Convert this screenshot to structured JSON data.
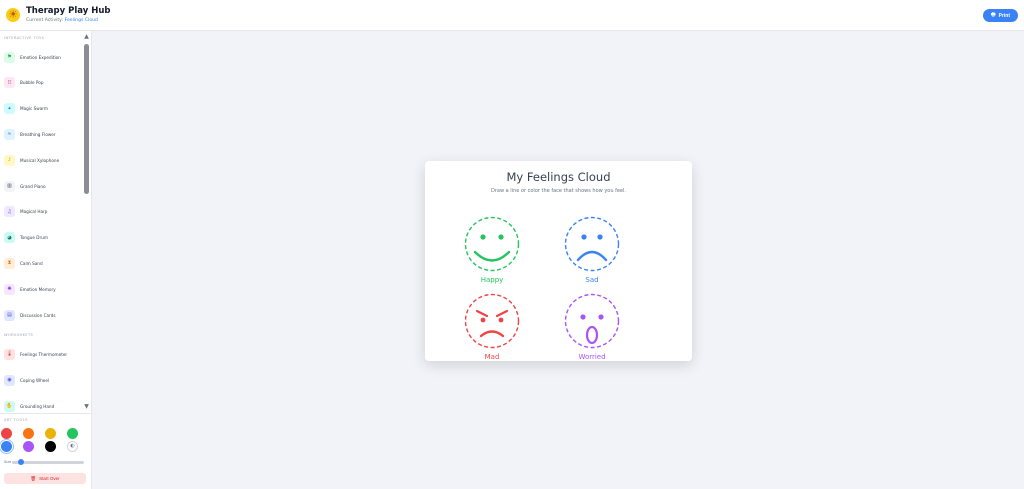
{
  "header": {
    "app_title": "Therapy Play Hub",
    "activity_prefix": "Current Activity:",
    "activity_name": "Feelings Cloud",
    "print_label": "Print"
  },
  "sidebar": {
    "interactive_label": "INTERACTIVE TOYS",
    "interactive": [
      {
        "label": "Emotion Expedition",
        "icon": "flag-icon",
        "bg": "#dcfce7",
        "fg": "#16a34a"
      },
      {
        "label": "Bubble Pop",
        "icon": "bubbles-icon",
        "bg": "#fce7f3",
        "fg": "#db2777"
      },
      {
        "label": "Magic Swarm",
        "icon": "sparkles-icon",
        "bg": "#cffafe",
        "fg": "#0891b2"
      },
      {
        "label": "Breathing Flower",
        "icon": "wind-icon",
        "bg": "#e0f2fe",
        "fg": "#0284c7"
      },
      {
        "label": "Musical Xylophone",
        "icon": "music-note-icon",
        "bg": "#fef9c3",
        "fg": "#ca8a04"
      },
      {
        "label": "Grand Piano",
        "icon": "piano-icon",
        "bg": "#f3f4f6",
        "fg": "#374151"
      },
      {
        "label": "Magical Harp",
        "icon": "harp-icon",
        "bg": "#ede9fe",
        "fg": "#7c3aed"
      },
      {
        "label": "Tongue Drum",
        "icon": "drum-icon",
        "bg": "#ccfbf1",
        "fg": "#0f766e"
      },
      {
        "label": "Calm Sand",
        "icon": "hourglass-icon",
        "bg": "#ffedd5",
        "fg": "#ea580c"
      },
      {
        "label": "Emotion Memory",
        "icon": "brain-icon",
        "bg": "#f3e8ff",
        "fg": "#9333ea"
      },
      {
        "label": "Discussion Cards",
        "icon": "cards-icon",
        "bg": "#e0e7ff",
        "fg": "#4f46e5"
      }
    ],
    "worksheets_label": "WORKSHEETS",
    "worksheets": [
      {
        "label": "Feelings Thermometer",
        "icon": "thermometer-icon",
        "bg": "#fee2e2",
        "fg": "#dc2626"
      },
      {
        "label": "Coping Wheel",
        "icon": "wheel-icon",
        "bg": "#e0e7ff",
        "fg": "#4f46e5"
      },
      {
        "label": "Grounding Hand",
        "icon": "hand-icon",
        "bg": "#ccfbf1",
        "fg": "#0d9488"
      }
    ],
    "art_tools_label": "ART TOOLS",
    "colors": [
      "#ef4444",
      "#f97316",
      "#eab308",
      "#22c55e",
      "#3b82f6",
      "#a855f7",
      "#000000"
    ],
    "selected_color": "#3b82f6",
    "size_label": "Size",
    "brush_size_fraction": 0.12,
    "start_over_label": "Start Over"
  },
  "card": {
    "title": "My Feelings Cloud",
    "subtitle": "Draw a line or color the face that shows how you feel.",
    "faces": [
      {
        "label": "Happy",
        "color": "#22c55e",
        "expression": "happy"
      },
      {
        "label": "Sad",
        "color": "#3b82f6",
        "expression": "sad"
      },
      {
        "label": "Mad",
        "color": "#ef4444",
        "expression": "mad"
      },
      {
        "label": "Worried",
        "color": "#a855f7",
        "expression": "worried"
      }
    ]
  }
}
